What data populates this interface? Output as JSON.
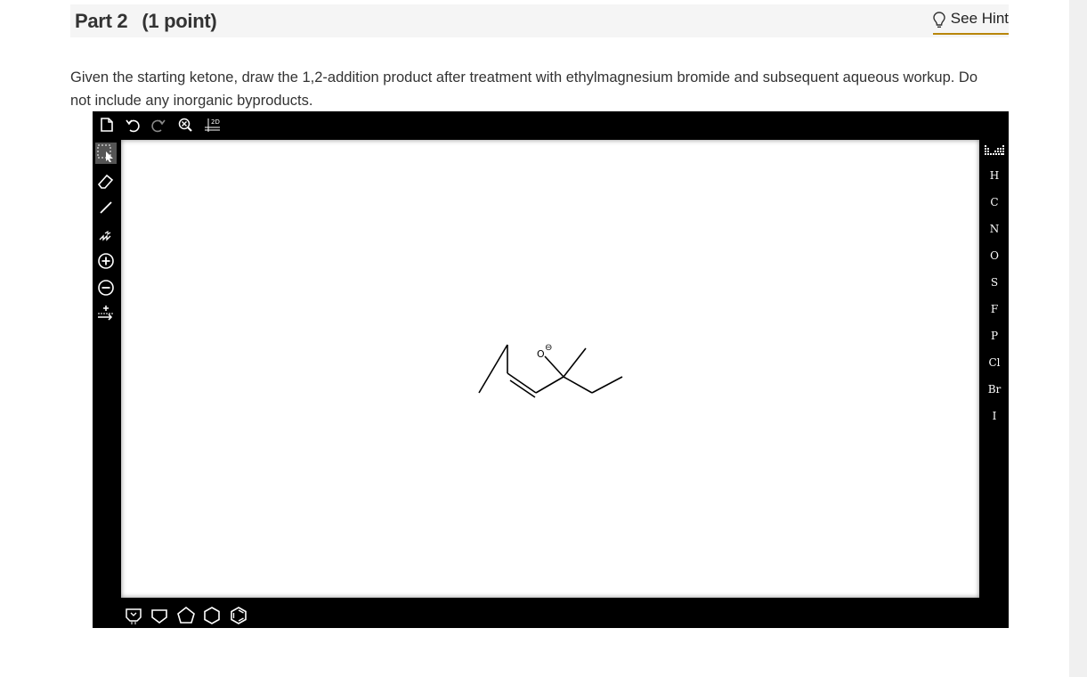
{
  "header": {
    "part_label": "Part 2",
    "points_label": "(1 point)",
    "hint_label": "See Hint"
  },
  "question": {
    "text": "Given the starting ketone, draw the 1,2-addition product after treatment with ethylmagnesium bromide and subsequent aqueous workup.  Do not include any inorganic byproducts."
  },
  "editor": {
    "top_toolbar": [
      "new-document-icon",
      "undo-icon",
      "redo-icon",
      "zoom-clear-icon",
      "clean-2d-icon"
    ],
    "clean_2d_label": "2D",
    "left_tools": [
      "select-icon",
      "erase-icon",
      "bond-icon",
      "chain-icon",
      "charge-plus-icon",
      "charge-minus-icon",
      "reaction-arrow-icon"
    ],
    "elements": [
      "H",
      "C",
      "N",
      "O",
      "S",
      "F",
      "P",
      "Cl",
      "Br",
      "I"
    ],
    "bottom_templates": [
      "template-icon",
      "cyclobutane-icon",
      "cyclopentane-icon",
      "cyclohexane-icon",
      "benzene-icon"
    ],
    "molecule": {
      "oxygen_label": "O",
      "charge_label": "⊖"
    }
  }
}
